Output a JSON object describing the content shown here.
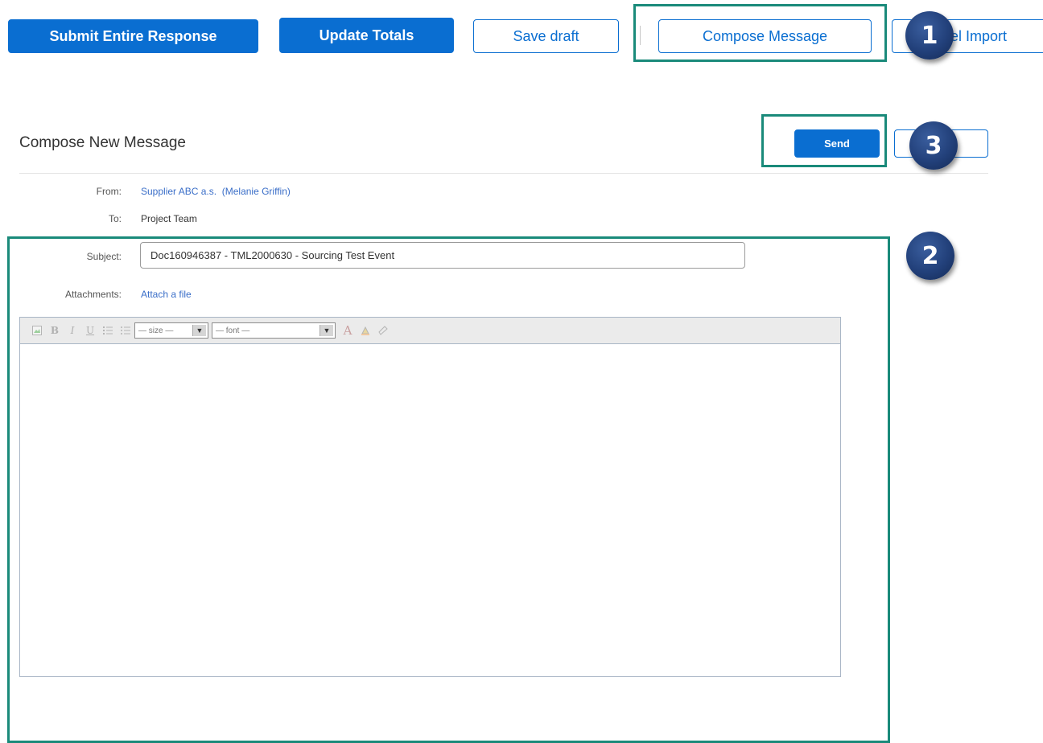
{
  "toolbar": {
    "submit_label": "Submit Entire Response",
    "update_label": "Update Totals",
    "save_label": "Save draft",
    "compose_label": "Compose Message",
    "import_label": "el Import"
  },
  "compose": {
    "title": "Compose New Message",
    "send_label": "Send",
    "from_label": "From:",
    "from_company": "Supplier ABC a.s.",
    "from_person": "(Melanie Griffin)",
    "to_label": "To:",
    "to_value": "Project Team",
    "subject_label": "Subject:",
    "subject_value": "Doc160946387 - TML2000630 - Sourcing Test Event",
    "attachments_label": "Attachments:",
    "attach_link": "Attach a file"
  },
  "editor": {
    "size_option": "— size —",
    "font_option": "— font —",
    "icons": [
      "image-icon",
      "bold-icon",
      "italic-icon",
      "underline-icon",
      "numbered-list-icon",
      "bullet-list-icon",
      "font-color-icon",
      "highlight-color-icon",
      "clear-format-icon"
    ]
  },
  "annotations": {
    "step1": "1",
    "step2": "2",
    "step3": "3",
    "color": "#1a8a7a",
    "badge_color": "#22407a"
  },
  "colors": {
    "primary": "#0a6ed1",
    "link": "#3a6ec8"
  }
}
